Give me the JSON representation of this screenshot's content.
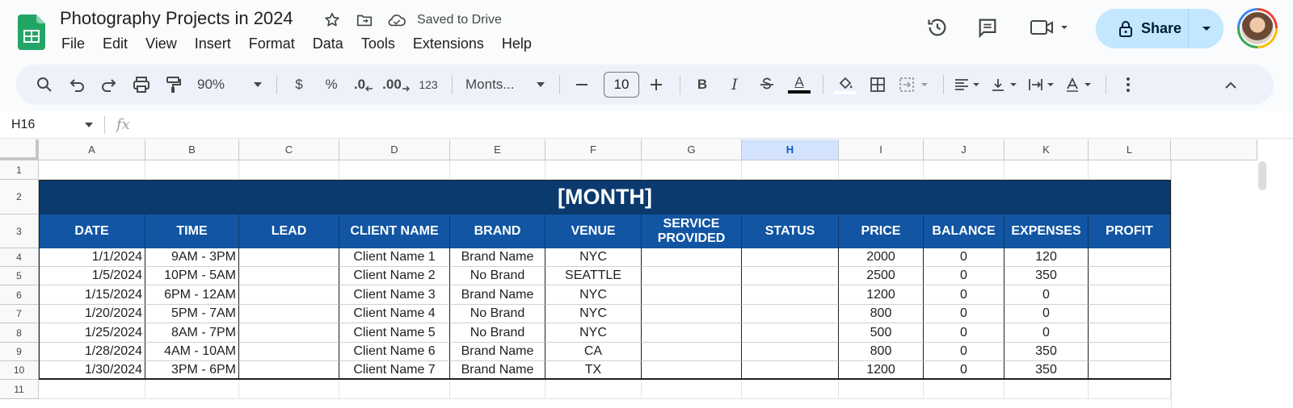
{
  "doc": {
    "title": "Photography Projects in 2024",
    "saved_status": "Saved to Drive"
  },
  "menu": [
    "File",
    "Edit",
    "View",
    "Insert",
    "Format",
    "Data",
    "Tools",
    "Extensions",
    "Help"
  ],
  "share": {
    "label": "Share"
  },
  "toolbar": {
    "zoom": "90%",
    "currency": "$",
    "percent": "%",
    "dec_decrease": ".0",
    "dec_increase": ".00",
    "format_123": "123",
    "font": "Monts...",
    "font_size": "10",
    "bold": "B",
    "italic": "I",
    "text_color": "A"
  },
  "formula_bar": {
    "cell_ref": "H16",
    "fx": "fx"
  },
  "columns": [
    "A",
    "B",
    "C",
    "D",
    "E",
    "F",
    "G",
    "H",
    "I",
    "J",
    "K",
    "L"
  ],
  "selected_column": "H",
  "rows": [
    "1",
    "2",
    "3",
    "4",
    "5",
    "6",
    "7",
    "8",
    "9",
    "10",
    "11"
  ],
  "sheet": {
    "month_title": "[MONTH]",
    "headers": [
      "DATE",
      "TIME",
      "LEAD",
      "CLIENT NAME",
      "BRAND",
      "VENUE",
      "SERVICE PROVIDED",
      "STATUS",
      "PRICE",
      "BALANCE",
      "EXPENSES",
      "PROFIT"
    ],
    "data": [
      [
        "1/1/2024",
        "9AM - 3PM",
        "",
        "Client Name 1",
        "Brand Name",
        "NYC",
        "",
        "",
        "2000",
        "0",
        "120",
        ""
      ],
      [
        "1/5/2024",
        "10PM - 5AM",
        "",
        "Client Name 2",
        "No Brand",
        "SEATTLE",
        "",
        "",
        "2500",
        "0",
        "350",
        ""
      ],
      [
        "1/15/2024",
        "6PM - 12AM",
        "",
        "Client Name 3",
        "Brand Name",
        "NYC",
        "",
        "",
        "1200",
        "0",
        "0",
        ""
      ],
      [
        "1/20/2024",
        "5PM - 7AM",
        "",
        "Client Name 4",
        "No Brand",
        "NYC",
        "",
        "",
        "800",
        "0",
        "0",
        ""
      ],
      [
        "1/25/2024",
        "8AM - 7PM",
        "",
        "Client Name 5",
        "No Brand",
        "NYC",
        "",
        "",
        "500",
        "0",
        "0",
        ""
      ],
      [
        "1/28/2024",
        "4AM - 10AM",
        "",
        "Client Name 6",
        "Brand Name",
        "CA",
        "",
        "",
        "800",
        "0",
        "350",
        ""
      ],
      [
        "1/30/2024",
        "3PM - 6PM",
        "",
        "Client Name 7",
        "Brand Name",
        "TX",
        "",
        "",
        "1200",
        "0",
        "350",
        ""
      ]
    ]
  },
  "colors": {
    "month_bg": "#0b3a6e",
    "header_bg": "#1155a3",
    "share_bg": "#c2e7ff",
    "toolbar_bg": "#edf2fa"
  }
}
